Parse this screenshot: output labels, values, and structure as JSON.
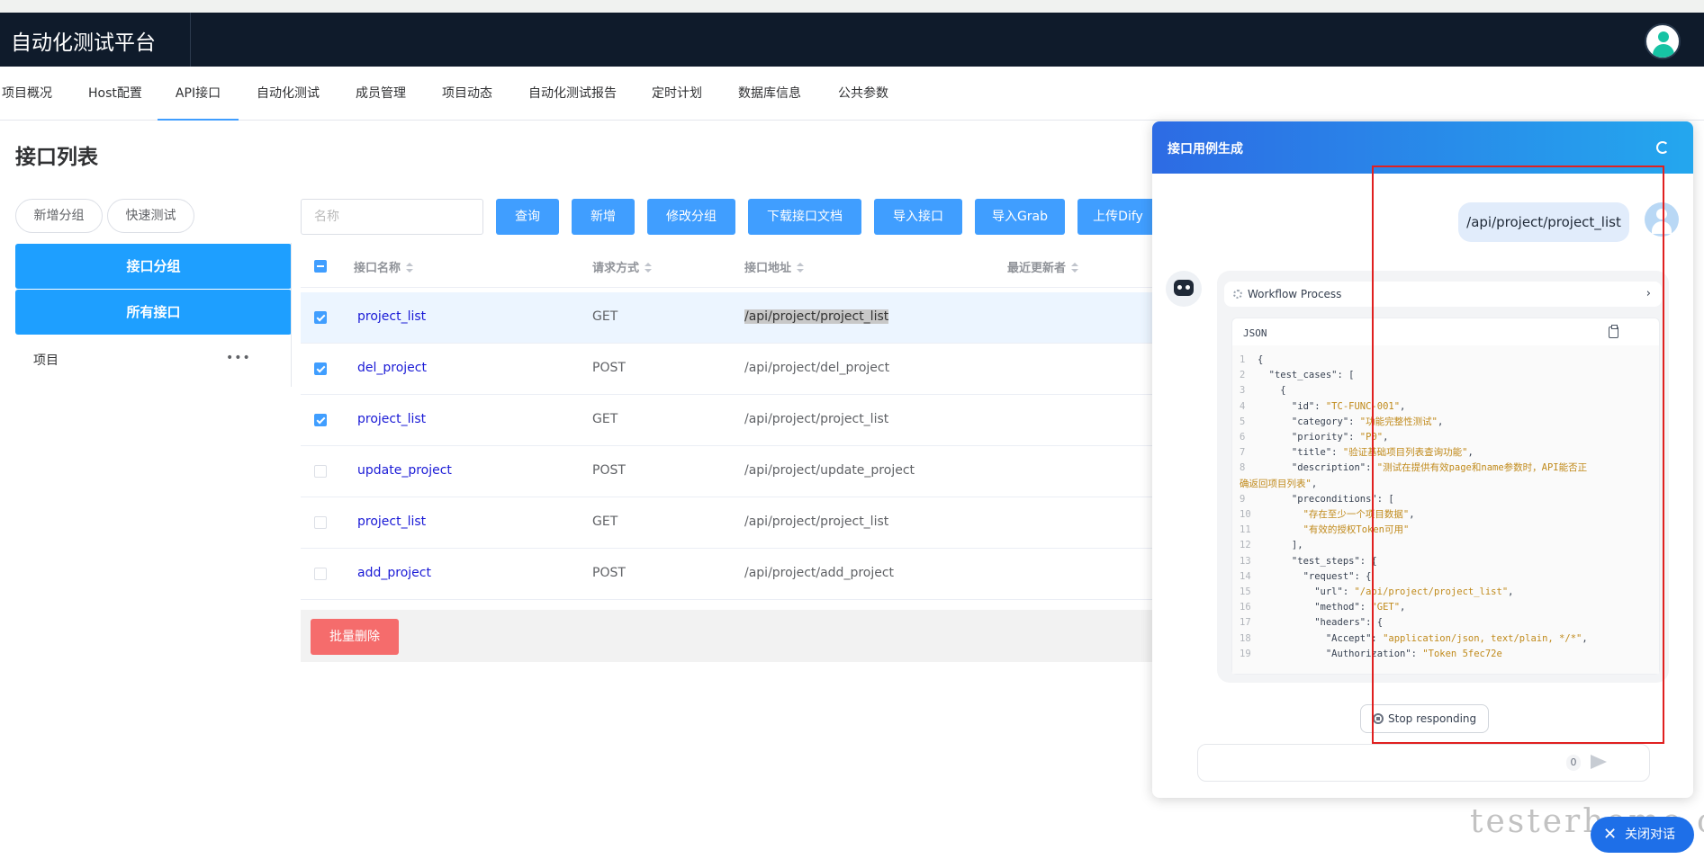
{
  "app": {
    "title": "自动化测试平台"
  },
  "nav": {
    "tabs": [
      "项目概况",
      "Host配置",
      "API接口",
      "自动化测试",
      "成员管理",
      "项目动态",
      "自动化测试报告",
      "定时计划",
      "数据库信息",
      "公共参数"
    ],
    "active": "API接口"
  },
  "page": {
    "title": "接口列表"
  },
  "sidebar": {
    "add_group": "新增分组",
    "quick_test": "快速测试",
    "group_header": "接口分组",
    "all_apis": "所有接口",
    "tree_item": "项目",
    "more": "•••"
  },
  "toolbar": {
    "search_placeholder": "名称",
    "buttons": [
      "查询",
      "新增",
      "修改分组",
      "下载接口文档",
      "导入接口",
      "导入Grab",
      "上传Dify"
    ]
  },
  "table": {
    "columns": [
      "接口名称",
      "请求方式",
      "接口地址",
      "最近更新者"
    ],
    "rows": [
      {
        "checked": true,
        "name": "project_list",
        "method": "GET",
        "url": "/api/project/project_list",
        "highlighted": true
      },
      {
        "checked": true,
        "name": "del_project",
        "method": "POST",
        "url": "/api/project/del_project"
      },
      {
        "checked": true,
        "name": "project_list",
        "method": "GET",
        "url": "/api/project/project_list"
      },
      {
        "checked": false,
        "name": "update_project",
        "method": "POST",
        "url": "/api/project/update_project"
      },
      {
        "checked": false,
        "name": "project_list",
        "method": "GET",
        "url": "/api/project/project_list"
      },
      {
        "checked": false,
        "name": "add_project",
        "method": "POST",
        "url": "/api/project/add_project"
      }
    ],
    "batch_delete": "批量删除"
  },
  "chat": {
    "title": "接口用例生成",
    "user_message": "/api/project/project_list",
    "workflow_label": "Workflow Process",
    "code_lang": "JSON",
    "code_lines": [
      [
        [
          "{",
          ""
        ]
      ],
      [
        [
          "  \"test_cases\": [",
          ""
        ]
      ],
      [
        [
          "    {",
          ""
        ]
      ],
      [
        [
          "      \"id\": ",
          ""
        ],
        [
          "\"TC-FUNC-001\"",
          "s"
        ],
        [
          ",",
          ""
        ]
      ],
      [
        [
          "      \"category\": ",
          ""
        ],
        [
          "\"功能完整性测试\"",
          "s"
        ],
        [
          ",",
          ""
        ]
      ],
      [
        [
          "      \"priority\": ",
          ""
        ],
        [
          "\"P0\"",
          "s"
        ],
        [
          ",",
          ""
        ]
      ],
      [
        [
          "      \"title\": ",
          ""
        ],
        [
          "\"验证基础项目列表查询功能\"",
          "s"
        ],
        [
          ",",
          ""
        ]
      ],
      [
        [
          "      \"description\": ",
          ""
        ],
        [
          "\"测试在提供有效page和name参数时，API能否正",
          "s"
        ]
      ],
      [
        [
          "确返回项目列表\"",
          "s"
        ],
        [
          ",",
          ""
        ]
      ],
      [
        [
          "      \"preconditions\": [",
          ""
        ]
      ],
      [
        [
          "        ",
          ""
        ],
        [
          "\"存在至少一个项目数据\"",
          "s"
        ],
        [
          ",",
          ""
        ]
      ],
      [
        [
          "        ",
          ""
        ],
        [
          "\"有效的授权Token可用\"",
          "s"
        ]
      ],
      [
        [
          "      ],",
          ""
        ]
      ],
      [
        [
          "      \"test_steps\": {",
          ""
        ]
      ],
      [
        [
          "        \"request\": {",
          ""
        ]
      ],
      [
        [
          "          \"url\": ",
          ""
        ],
        [
          "\"/api/project/project_list\"",
          "s"
        ],
        [
          ",",
          ""
        ]
      ],
      [
        [
          "          \"method\": ",
          ""
        ],
        [
          "\"GET\"",
          "s"
        ],
        [
          ",",
          ""
        ]
      ],
      [
        [
          "          \"headers\": {",
          ""
        ]
      ],
      [
        [
          "            \"Accept\": ",
          ""
        ],
        [
          "\"application/json, text/plain, */*\"",
          "s"
        ],
        [
          ",",
          ""
        ]
      ],
      [
        [
          "            \"Authorization\": ",
          ""
        ],
        [
          "\"Token 5fec72e",
          "s"
        ]
      ]
    ],
    "line_numbers": [
      "1",
      "2",
      "3",
      "4",
      "5",
      "6",
      "7",
      "8",
      "",
      "9",
      "10",
      "11",
      "12",
      "13",
      "14",
      "15",
      "16",
      "17",
      "18",
      "19"
    ],
    "stop_label": "Stop responding",
    "input_counter": "0",
    "close_label": "关闭对话"
  },
  "watermark": "testerhome.com"
}
